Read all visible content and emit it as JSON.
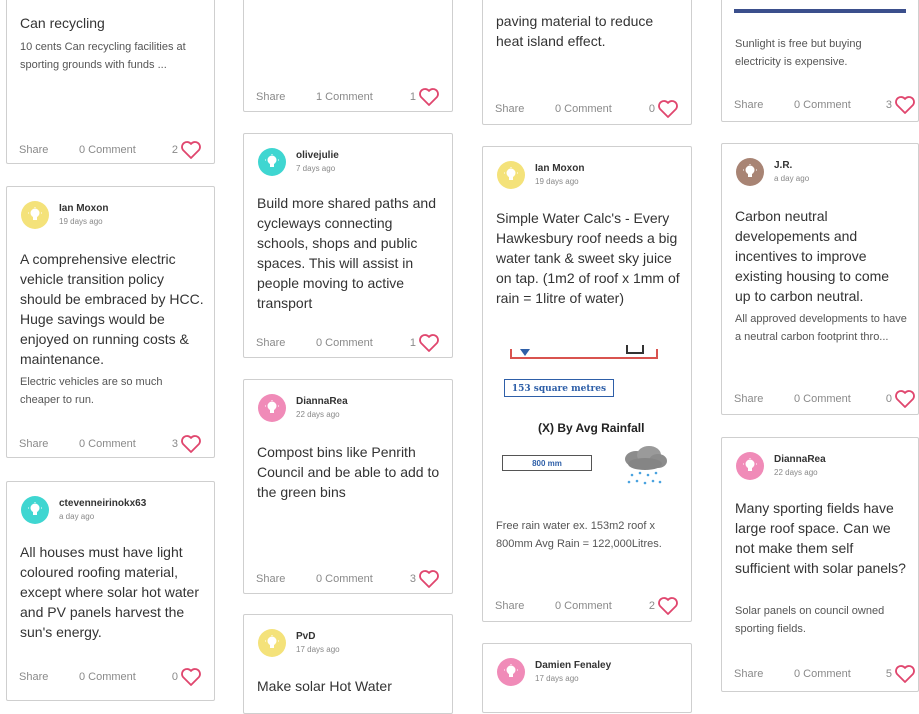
{
  "cards": {
    "c1": {
      "title": "Can recycling",
      "desc": "10 cents Can recycling facilities at sporting grounds with funds ...",
      "share": "Share",
      "comment": "0 Comment",
      "likes": "2"
    },
    "c2": {
      "name": "Ian Moxon",
      "time": "19 days ago",
      "title": "A comprehensive electric vehicle transition policy should be embraced by HCC. Huge savings would be enjoyed on running costs & maintenance.",
      "desc": "Electric vehicles are so much cheaper to run.",
      "share": "Share",
      "comment": "0 Comment",
      "likes": "3"
    },
    "c3": {
      "name": "ctevenneirinokx63",
      "time": "a day ago",
      "title": "All houses must have light coloured roofing material, except where solar hot water and PV panels harvest the sun's energy.",
      "share": "Share",
      "comment": "0 Comment",
      "likes": "0"
    },
    "c4": {
      "share": "Share",
      "comment": "1 Comment",
      "likes": "1"
    },
    "c5": {
      "name": "olivejulie",
      "time": "7 days ago",
      "title": "Build more shared paths and cycleways connecting schools, shops and public spaces. This will assist in people moving to active transport",
      "share": "Share",
      "comment": "0 Comment",
      "likes": "1"
    },
    "c6": {
      "name": "DiannaRea",
      "time": "22 days ago",
      "title": "Compost bins like Penrith Council and be able to add to the green bins",
      "share": "Share",
      "comment": "0 Comment",
      "likes": "3"
    },
    "c7": {
      "name": "PvD",
      "time": "17 days ago",
      "title": "Make solar Hot Water"
    },
    "c8": {
      "title": "paving material to reduce heat island effect.",
      "share": "Share",
      "comment": "0 Comment",
      "likes": "0"
    },
    "c9": {
      "name": "Ian Moxon",
      "time": "19 days ago",
      "title": "Simple Water Calc's - Every Hawkesbury roof needs a big water tank & sweet sky juice on tap. (1m2 of roof x 1mm of rain = 1litre of water)",
      "img_area": "153 square metres",
      "img_heading": "(X) By Avg Rainfall",
      "img_rain": "800 mm",
      "desc": "Free rain water ex. 153m2 roof x 800mm Avg Rain = 122,000Litres.",
      "share": "Share",
      "comment": "0 Comment",
      "likes": "2"
    },
    "c10": {
      "name": "Damien Fenaley",
      "time": "17 days ago"
    },
    "c11": {
      "desc": "Sunlight is free but buying electricity is expensive.",
      "share": "Share",
      "comment": "0 Comment",
      "likes": "3"
    },
    "c12": {
      "name": "J.R.",
      "time": "a day ago",
      "title": "Carbon neutral developements and incentives to improve existing housing to come up to carbon neutral.",
      "desc": "All approved developments to have a neutral carbon footprint thro...",
      "share": "Share",
      "comment": "0 Comment",
      "likes": "0"
    },
    "c13": {
      "name": "DiannaRea",
      "time": "22 days ago",
      "title": "Many sporting fields have large roof space. Can we not make them self sufficient with solar panels?",
      "desc": "Solar panels on council owned sporting fields.",
      "share": "Share",
      "comment": "0 Comment",
      "likes": "5"
    }
  },
  "colors": {
    "yellow": "#f4e27a",
    "teal": "#3fd6d1",
    "pink": "#f08bb8",
    "brown": "#a88474",
    "heart": "#e0466e"
  },
  "icons": {
    "avatar": "lightbulb-icon",
    "like": "heart-icon"
  }
}
